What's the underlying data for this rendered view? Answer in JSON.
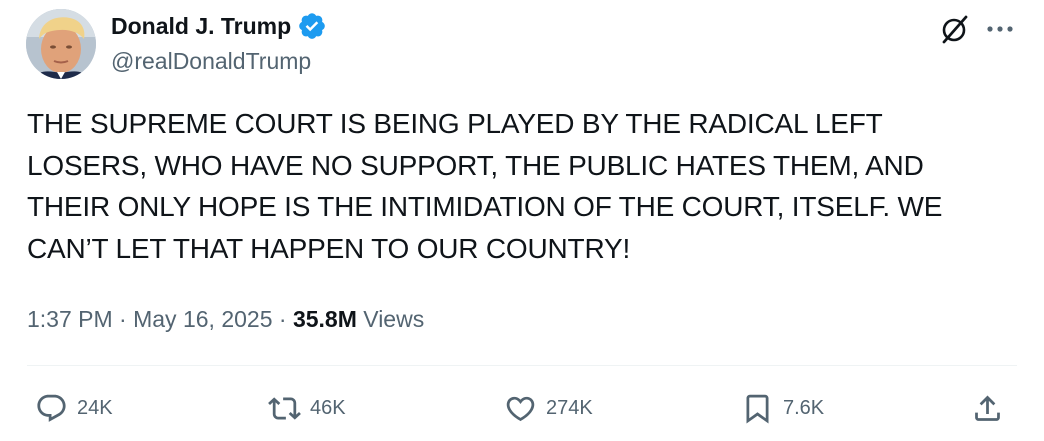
{
  "author": {
    "display_name": "Donald J. Trump",
    "handle": "@realDonaldTrump",
    "verified_badge_color": "#1d9bf0",
    "avatar_icon": "profile-photo"
  },
  "header_icons": {
    "grok": "grok-icon",
    "more": "more-icon"
  },
  "tweet": {
    "lines": [
      "THE SUPREME COURT IS BEING PLAYED BY THE RADICAL LEFT",
      "LOSERS, WHO HAVE NO SUPPORT, THE PUBLIC HATES THEM, AND",
      "THEIR ONLY HOPE IS THE INTIMIDATION OF THE COURT, ITSELF. WE",
      "CAN’T LET THAT HAPPEN TO OUR COUNTRY!"
    ]
  },
  "meta": {
    "time": "1:37 PM",
    "separator": "·",
    "date": "May 16, 2025",
    "views_count": "35.8M",
    "views_label": "Views"
  },
  "actions": {
    "reply": {
      "icon": "reply-icon",
      "count": "24K"
    },
    "repost": {
      "icon": "repost-icon",
      "count": "46K"
    },
    "like": {
      "icon": "heart-icon",
      "count": "274K"
    },
    "bookmark": {
      "icon": "bookmark-icon",
      "count": "7.6K"
    },
    "share": {
      "icon": "share-icon"
    }
  },
  "colors": {
    "text_primary": "#0f1419",
    "text_secondary": "#536471",
    "divider": "#eff3f4"
  }
}
